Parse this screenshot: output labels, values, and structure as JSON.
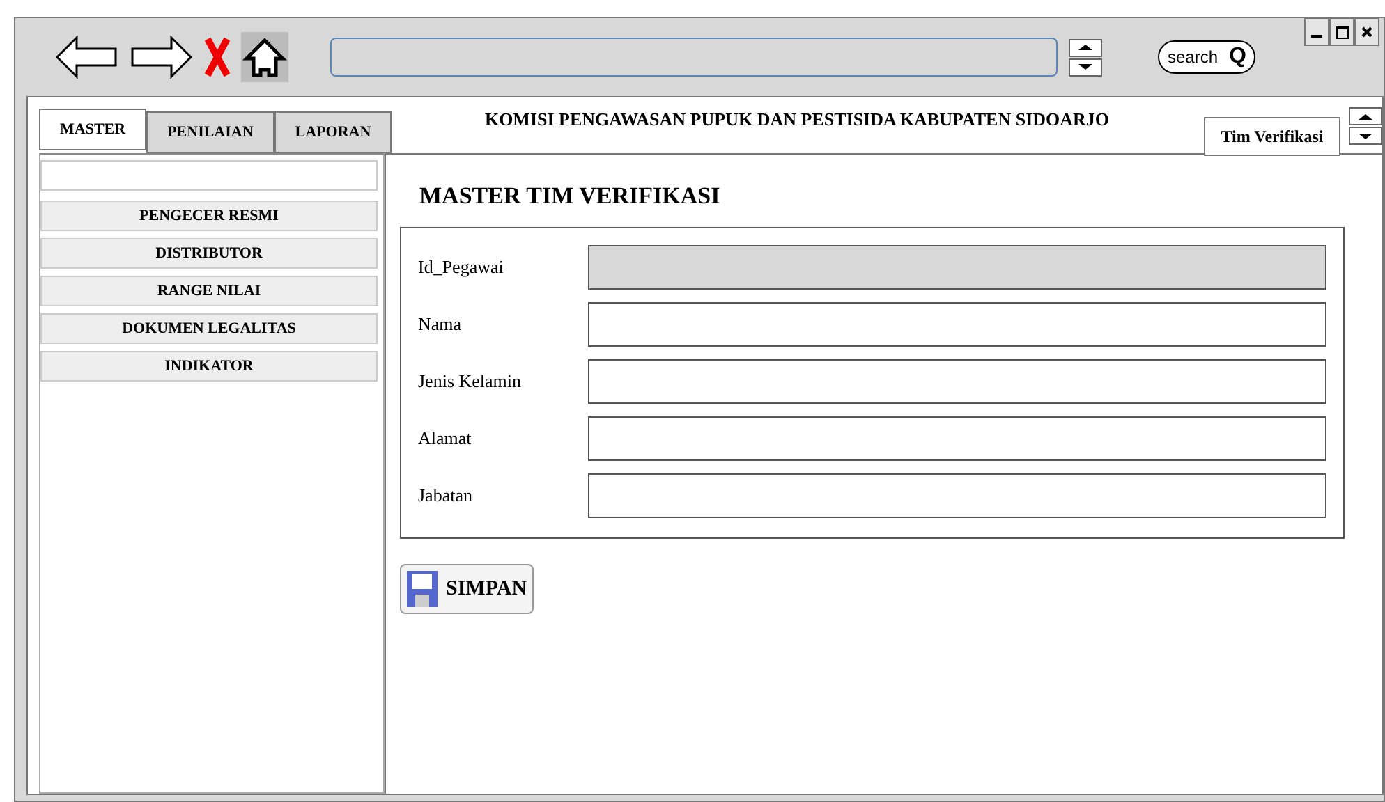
{
  "toolbar": {
    "search_label": "search",
    "search_icon": "Q"
  },
  "tabs": [
    {
      "label": "MASTER",
      "selected": true
    },
    {
      "label": "PENILAIAN",
      "selected": false
    },
    {
      "label": "LAPORAN",
      "selected": false
    }
  ],
  "header": {
    "title": "KOMISI PENGAWASAN PUPUK DAN PESTISIDA KABUPATEN SIDOARJO",
    "dropdown": "Tim Verifikasi"
  },
  "sidebar": {
    "items": [
      {
        "label": "PENGECER RESMI"
      },
      {
        "label": "DISTRIBUTOR"
      },
      {
        "label": "RANGE NILAI"
      },
      {
        "label": "DOKUMEN LEGALITAS"
      },
      {
        "label": "INDIKATOR"
      }
    ]
  },
  "form": {
    "title": "MASTER TIM VERIFIKASI",
    "fields": [
      {
        "label": "Id_Pegawai",
        "disabled": true
      },
      {
        "label": "Nama",
        "disabled": false
      },
      {
        "label": "Jenis Kelamin",
        "disabled": false
      },
      {
        "label": "Alamat",
        "disabled": false
      },
      {
        "label": "Jabatan",
        "disabled": false
      }
    ],
    "save_button": "SIMPAN"
  }
}
